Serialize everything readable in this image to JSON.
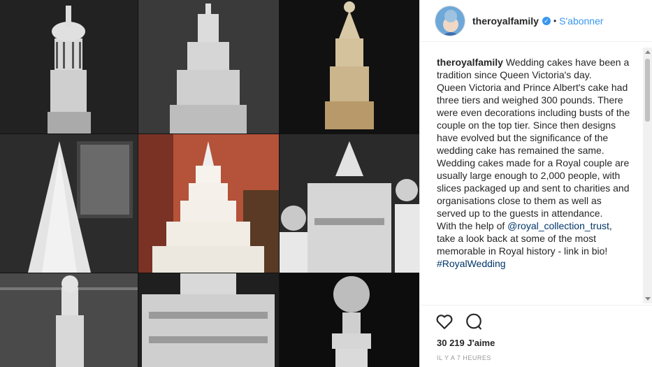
{
  "post": {
    "username": "theroyalfamily",
    "verified_mark": "✓",
    "dot": "•",
    "follow_label": "S'abonner",
    "caption": {
      "user": "theroyalfamily",
      "part1": " Wedding cakes have been a tradition since Queen Victoria's day.\nQueen Victoria and Prince Albert's cake had three tiers and weighed 300 pounds. There were even decorations including busts of the couple on the top tier. Since then designs have evolved but the significance of the wedding cake has remained the same.\nWedding cakes made for a Royal couple are usually large enough to 2,000 people, with slices packaged up and sent to charities and organisations close to them as well as served up to the guests in attendance.\nWith the help of ",
      "mention": "@royal_collection_trust",
      "part2": ",\ntake a look back at some of the most memorable in Royal history - link in bio!\n",
      "hashtag": "#RoyalWedding"
    },
    "likes": "30 219 J'aime",
    "time": "IL Y A 7 HEURES"
  },
  "icons": {
    "like": "heart-icon",
    "comment": "comment-icon",
    "verified": "verified-badge-icon"
  },
  "colors": {
    "link_blue": "#3897f0",
    "hashtag": "#003569"
  }
}
